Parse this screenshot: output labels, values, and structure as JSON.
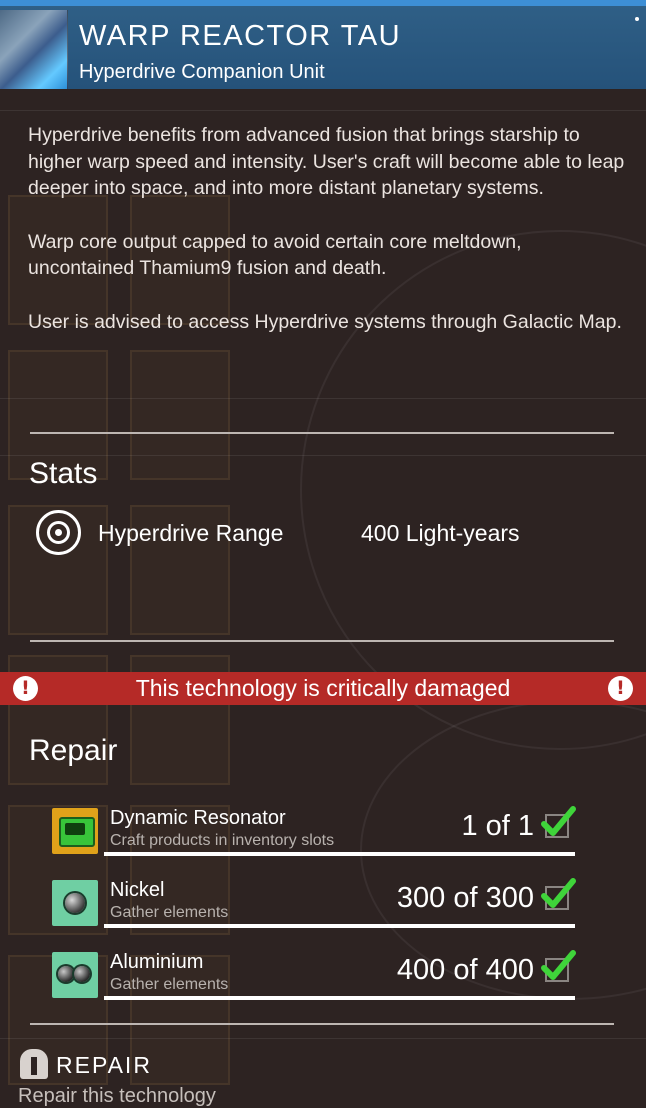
{
  "header": {
    "title": "WARP REACTOR TAU",
    "subtitle": "Hyperdrive Companion Unit",
    "thumbnail_icon": "warp-reactor-thumbnail",
    "accent_color": "#3d8fd6"
  },
  "description": {
    "paragraphs": [
      "Hyperdrive benefits from advanced fusion that brings starship to higher warp speed and intensity. User's craft will become able to leap deeper into space, and into more distant planetary systems.",
      "Warp core output capped to avoid certain core meltdown, uncontained Thamium9 fusion and death.",
      "User is advised to access Hyperdrive systems through Galactic Map."
    ]
  },
  "stats": {
    "title": "Stats",
    "items": [
      {
        "icon": "target-icon",
        "name": "Hyperdrive Range",
        "value": "400 Light-years"
      }
    ]
  },
  "warning": {
    "text": "This technology is critically damaged",
    "icon": "exclamation-icon",
    "color": "#b52a27"
  },
  "repair": {
    "title": "Repair",
    "requirements": [
      {
        "icon": "dynamic-resonator-icon",
        "name": "Dynamic Resonator",
        "subtitle": "Craft products in inventory slots",
        "quantity": "1 of 1",
        "satisfied": true
      },
      {
        "icon": "nickel-icon",
        "name": "Nickel",
        "subtitle": "Gather elements",
        "quantity": "300 of 300",
        "satisfied": true
      },
      {
        "icon": "aluminium-icon",
        "name": "Aluminium",
        "subtitle": "Gather elements",
        "quantity": "400 of 400",
        "satisfied": true
      }
    ],
    "action": {
      "label": "REPAIR",
      "subtitle": "Repair this technology",
      "icon": "repair-tool-icon"
    }
  }
}
